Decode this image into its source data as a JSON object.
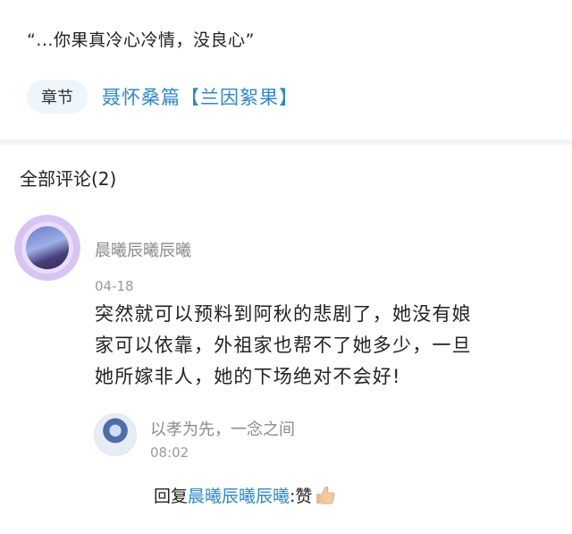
{
  "post": {
    "quote": "“...你果真冷心冷情，没良心”",
    "chapter_chip": "章节",
    "chapter_link": "聂怀桑篇【兰因絮果】"
  },
  "comments_section": {
    "title": "全部评论(2)"
  },
  "comment": {
    "username": "晨曦辰曦辰曦",
    "date": "04-18",
    "lines": [
      "突然就可以预料到阿秋的悲剧了，她没有娘",
      "家可以依靠，外祖家也帮不了她多少，一旦",
      "她所嫁非人，她的下场绝对不会好!"
    ]
  },
  "reply": {
    "username": "以孝为先，一念之间",
    "date": "08:02",
    "prefix": "回复",
    "target": "晨曦辰曦辰曦",
    "text": ":赞",
    "emoji_icon": "thumbs-up-icon"
  },
  "colors": {
    "link": "#2f88c8",
    "muted": "#8a8a8a",
    "chip_bg": "#eef6fb"
  }
}
